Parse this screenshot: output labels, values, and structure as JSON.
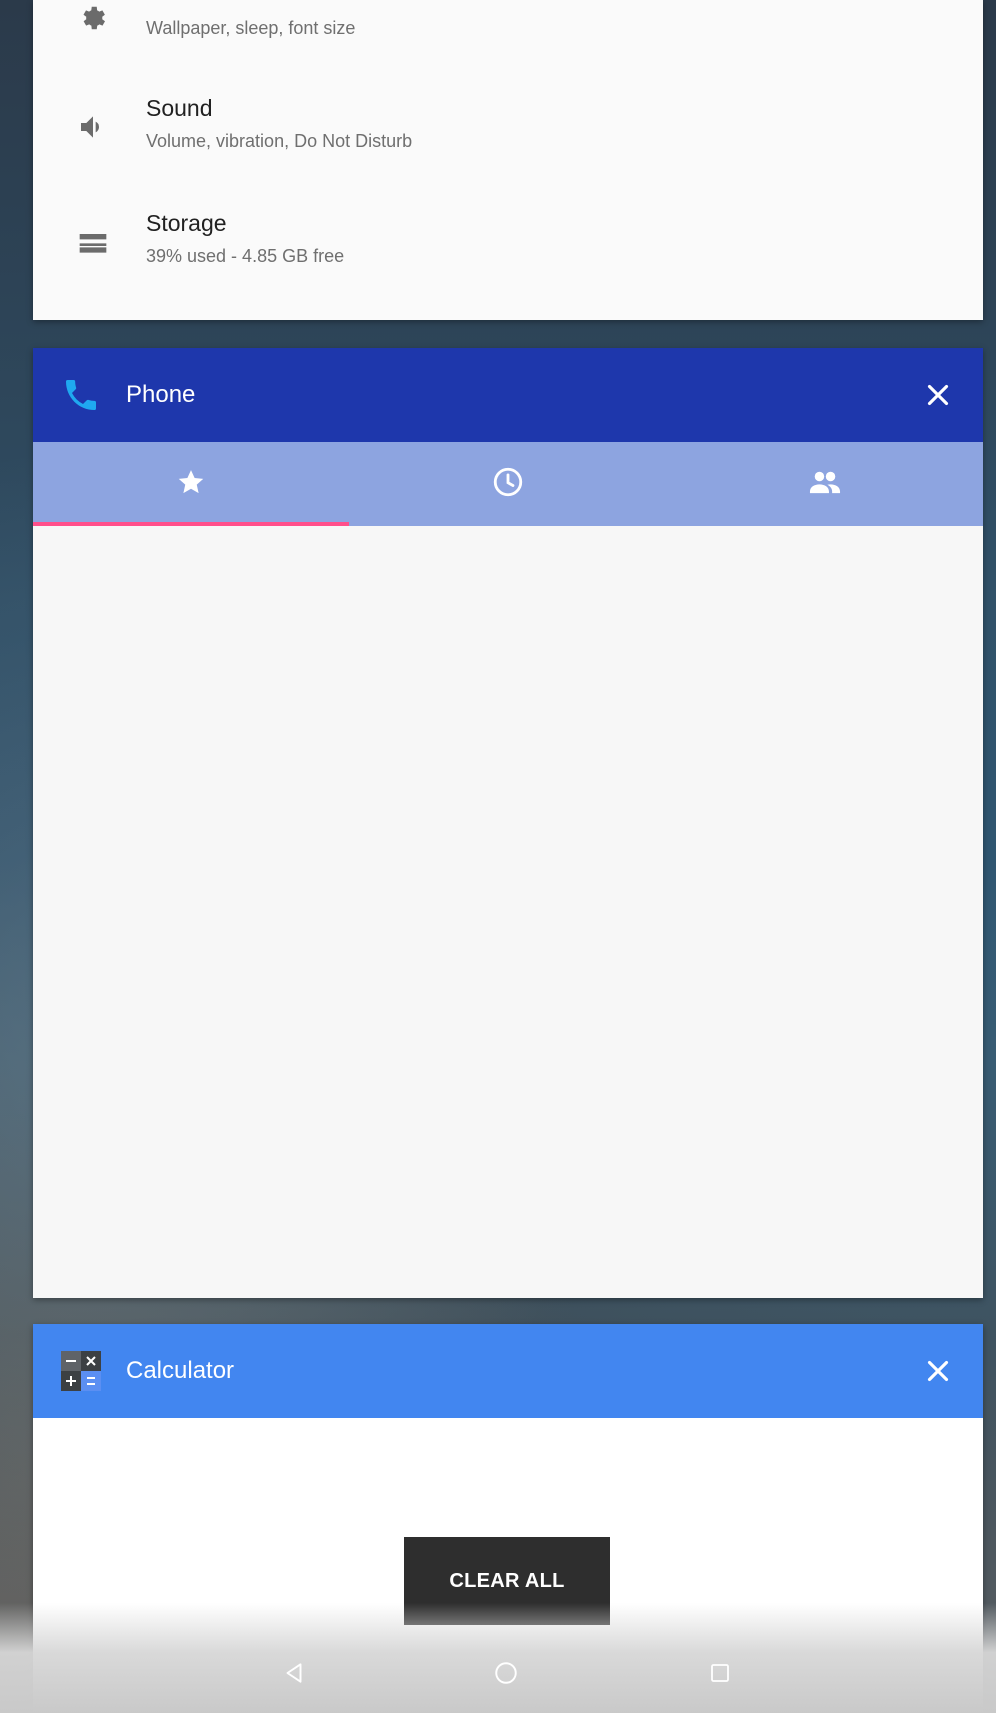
{
  "settings_card": {
    "items": [
      {
        "icon": "display-gear-icon",
        "title": "",
        "subtitle": "Wallpaper, sleep, font size"
      },
      {
        "icon": "volume-icon",
        "title": "Sound",
        "subtitle": "Volume, vibration, Do Not Disturb"
      },
      {
        "icon": "storage-icon",
        "title": "Storage",
        "subtitle": "39% used - 4.85 GB free"
      }
    ]
  },
  "phone_card": {
    "title": "Phone",
    "header_color": "#1e37ac",
    "tabs": [
      {
        "icon": "star-icon",
        "selected": true
      },
      {
        "icon": "clock-icon",
        "selected": false
      },
      {
        "icon": "people-icon",
        "selected": false
      }
    ],
    "accent": "#ff4f8b"
  },
  "calculator_card": {
    "title": "Calculator",
    "header_color": "#4286f0"
  },
  "clear_all_label": "CLEAR ALL",
  "nav": {
    "buttons": [
      "back-icon",
      "home-icon",
      "recents-icon"
    ]
  }
}
